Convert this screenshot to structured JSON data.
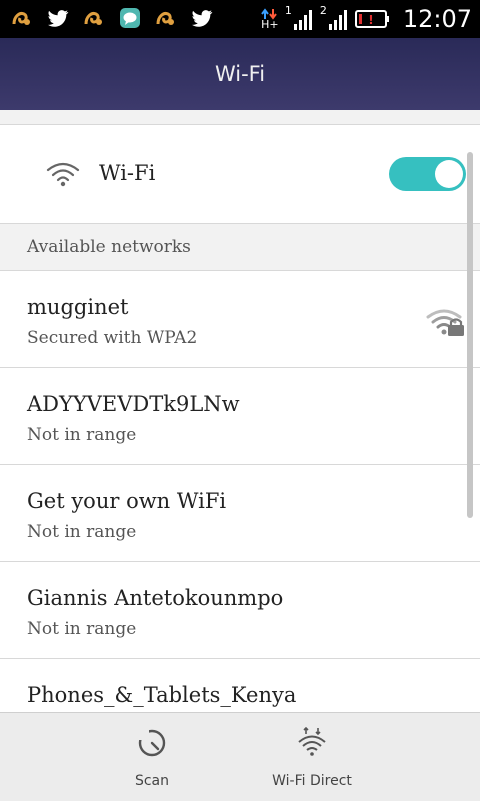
{
  "status_bar": {
    "time": "12:07",
    "sim1_label": "1",
    "sim2_label": "2",
    "network_type": "H+",
    "notification_icons": [
      "uc-browser-icon",
      "twitter-icon",
      "uc-browser-icon",
      "chat-icon",
      "uc-browser-icon",
      "twitter-icon"
    ],
    "battery_level": 0.1
  },
  "header": {
    "title": "Wi-Fi"
  },
  "wifi_toggle": {
    "label": "Wi-Fi",
    "enabled": true,
    "accent": "#36c0c0"
  },
  "section": {
    "title": "Available networks"
  },
  "networks": [
    {
      "name": "mugginet",
      "status": "Secured with WPA2"
    },
    {
      "name": "ADYYVEVDTk9LNw",
      "status": "Not in range"
    },
    {
      "name": "Get your own WiFi",
      "status": "Not in range"
    },
    {
      "name": "Giannis Antetokounmpo",
      "status": "Not in range"
    },
    {
      "name": "Phones_&_Tablets_Kenya",
      "status": ""
    }
  ],
  "bottom_bar": {
    "scan_label": "Scan",
    "wifi_direct_label": "Wi-Fi Direct"
  }
}
